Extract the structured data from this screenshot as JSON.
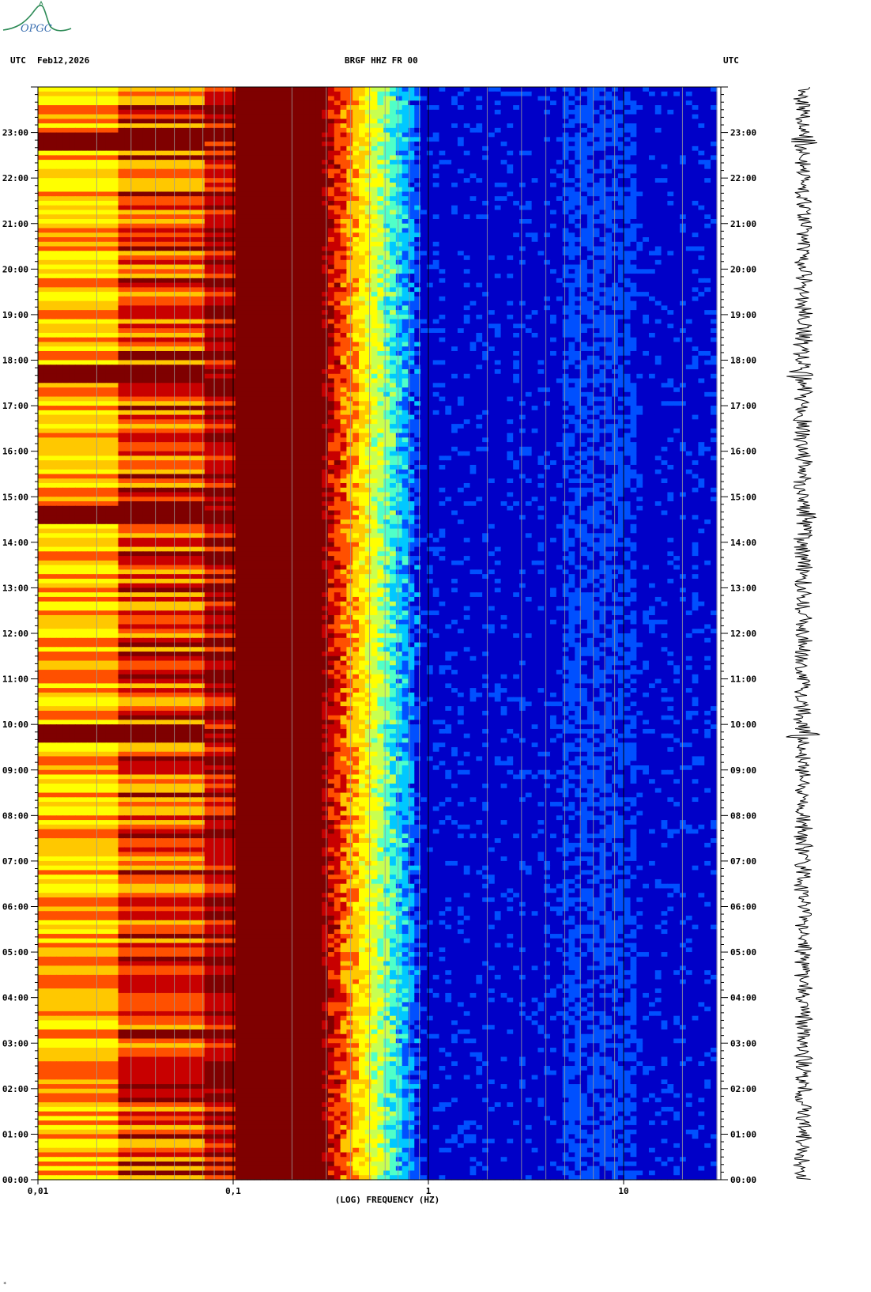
{
  "header": {
    "left_tz": "UTC",
    "date": "Feb12,2026",
    "station": "BRGF HHZ FR 00",
    "right_tz": "UTC"
  },
  "logo": {
    "text": "OPGC",
    "color": "#2e8b57"
  },
  "footer_mark": "*",
  "chart_data": {
    "type": "heatmap",
    "title": "BRGF HHZ FR 00",
    "xlabel": "(LOG) FREQUENCY (HZ)",
    "xscale": "log",
    "xlim": [
      0.01,
      30
    ],
    "x_tick_labels": [
      "0,01",
      "0,1",
      "1",
      "10"
    ],
    "x_tick_values": [
      0.01,
      0.1,
      1,
      10
    ],
    "y_tick_labels": [
      "00:00",
      "01:00",
      "02:00",
      "03:00",
      "04:00",
      "05:00",
      "06:00",
      "07:00",
      "08:00",
      "09:00",
      "10:00",
      "11:00",
      "12:00",
      "13:00",
      "14:00",
      "15:00",
      "16:00",
      "17:00",
      "18:00",
      "19:00",
      "20:00",
      "21:00",
      "22:00",
      "23:00"
    ],
    "ylim_hours": [
      0,
      24
    ],
    "grid": true,
    "colormap": [
      "#00007f",
      "#0000c8",
      "#0050ff",
      "#00c8ff",
      "#50ffc8",
      "#c8ff50",
      "#ffff00",
      "#ffc800",
      "#ff5000",
      "#c80000",
      "#7f0000"
    ],
    "events_hours": [
      9.8,
      14.6,
      17.7,
      22.8
    ],
    "side_trace": "seismogram"
  }
}
